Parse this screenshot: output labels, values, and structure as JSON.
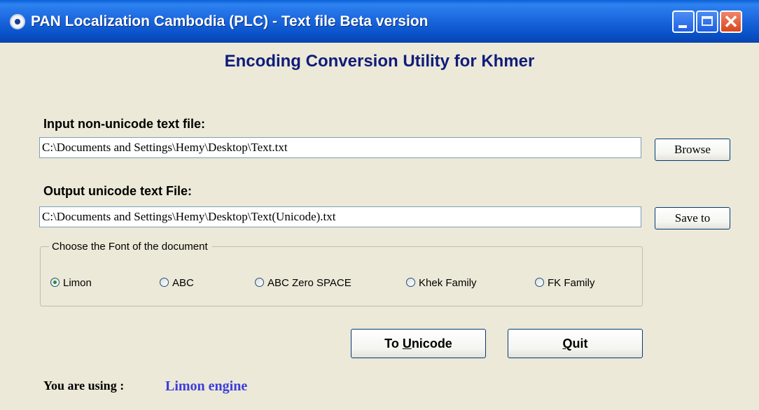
{
  "window": {
    "title": "PAN Localization Cambodia (PLC) - Text file Beta version",
    "close_glyph": "✕"
  },
  "heading": "Encoding Conversion Utility for Khmer",
  "input": {
    "label": "Input non-unicode text file:",
    "value": "C:\\Documents and Settings\\Hemy\\Desktop\\Text.txt",
    "button_label": "Browse"
  },
  "output": {
    "label": "Output unicode text File:",
    "value": "C:\\Documents and Settings\\Hemy\\Desktop\\Text(Unicode).txt",
    "button_label": "Save to"
  },
  "font_group": {
    "title": "Choose the Font of the document",
    "options": [
      {
        "label": "Limon",
        "selected": true
      },
      {
        "label": "ABC",
        "selected": false
      },
      {
        "label": "ABC Zero SPACE",
        "selected": false
      },
      {
        "label": "Khek Family",
        "selected": false
      },
      {
        "label": "FK Family",
        "selected": false
      }
    ]
  },
  "actions": {
    "to_unicode_prefix": "To ",
    "to_unicode_mnemonic": "U",
    "to_unicode_rest": "nicode",
    "quit_mnemonic": "Q",
    "quit_rest": "uit"
  },
  "status": {
    "label": "You are using :",
    "value": "Limon engine"
  },
  "colors": {
    "titlebar": "#0a52c8",
    "heading": "#0f1c7a",
    "status_value": "#3c3cdc",
    "background": "#ece9d8"
  }
}
